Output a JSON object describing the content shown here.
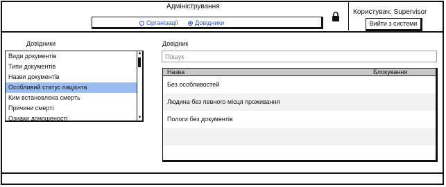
{
  "header": {
    "title": "Адміністрування",
    "radio_options": [
      {
        "label": "Організації",
        "selected": false
      },
      {
        "label": "Довідники",
        "selected": true
      }
    ],
    "user_label": "Користувач: Supervisor",
    "logout_label": "Вийти з системи"
  },
  "left": {
    "title": "Довідники",
    "items": [
      "Види документів",
      "Типи документів",
      "Назви документів",
      "Особливий статус пацієнта",
      "Ким встановлена смерть",
      "Причини смерті",
      "Ознаки доношеності"
    ],
    "selected_index": 3
  },
  "right": {
    "title": "Довідник",
    "search_placeholder": "Пошук",
    "columns": [
      "Назва",
      "Блокування"
    ],
    "rows": [
      "Без особливостей",
      "Людина без певного місця проживання",
      "Пологи без документів",
      "",
      ""
    ]
  },
  "colors": {
    "accent": "#2b4fd0",
    "selected_row": "#9bbcf0",
    "header_bg": "#c8c8c8"
  }
}
